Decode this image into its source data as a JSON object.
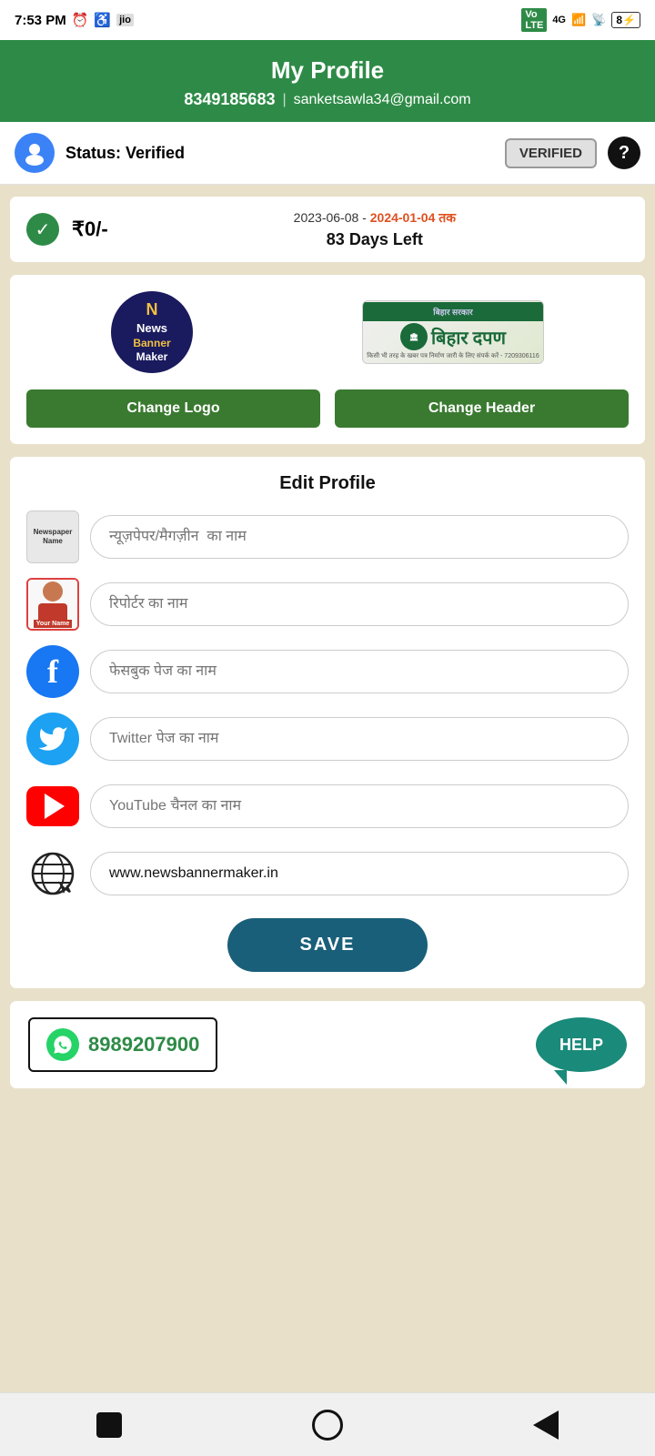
{
  "statusBar": {
    "time": "7:53 PM",
    "icons": [
      "alarm",
      "accessibility",
      "signal-4g",
      "wifi",
      "battery"
    ]
  },
  "header": {
    "title": "My Profile",
    "phone": "8349185683",
    "email": "sanketsawla34@gmail.com",
    "divider": "|"
  },
  "verifiedBar": {
    "statusLabel": "Status: ",
    "statusValue": "Verified",
    "badgeLabel": "VERIFIED",
    "helpLabel": "?"
  },
  "subscription": {
    "amount": "₹0/-",
    "startDate": "2023-06-08",
    "dash": " - ",
    "endDate": "2024-01-04",
    "endSuffix": " तक",
    "daysLeft": "83 Days Left"
  },
  "logoSection": {
    "logoText1": "News",
    "logoText2": "Banner",
    "logoText3": "Maker",
    "headerText": "बिहार दपण",
    "headerSub": "किसी भी तरह के खबर पत्र निर्माण जारी के लिए संपर्क करें - 7209306116",
    "changeLogoBtn": "Change Logo",
    "changeHeaderBtn": "Change Header"
  },
  "editProfile": {
    "title": "Edit Profile",
    "fields": [
      {
        "id": "newspaper",
        "iconType": "newspaper",
        "placeholder": "न्यूज़पेपर/मैगज़ीन  का नाम",
        "value": ""
      },
      {
        "id": "reporter",
        "iconType": "reporter",
        "placeholder": "रिपोर्टर का नाम",
        "value": ""
      },
      {
        "id": "facebook",
        "iconType": "facebook",
        "placeholder": "फेसबुक पेज का नाम",
        "value": ""
      },
      {
        "id": "twitter",
        "iconType": "twitter",
        "placeholder": "Twitter पेज का नाम",
        "value": ""
      },
      {
        "id": "youtube",
        "iconType": "youtube",
        "placeholder": "YouTube चैनल का नाम",
        "value": ""
      },
      {
        "id": "website",
        "iconType": "website",
        "placeholder": "www.newsbannermaker.in",
        "value": "www.newsbannermaker.in"
      }
    ],
    "saveButton": "SAVE"
  },
  "contact": {
    "whatsappNumber": "8989207900",
    "helpLabel": "HELP"
  },
  "bottomNav": {
    "buttons": [
      "square",
      "circle",
      "triangle"
    ]
  }
}
